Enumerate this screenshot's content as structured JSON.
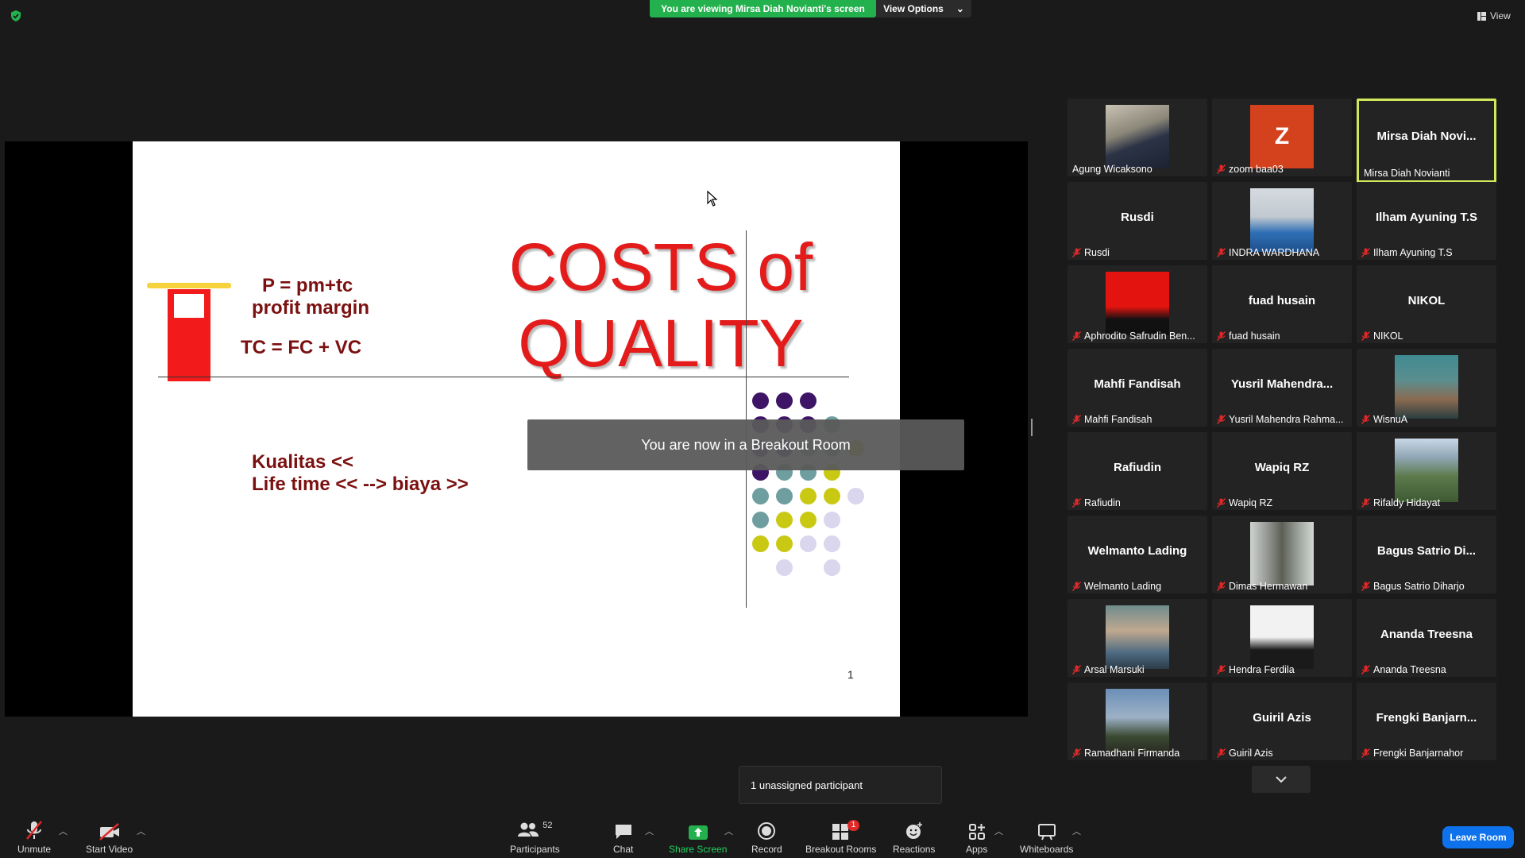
{
  "top": {
    "viewing_banner": "You are viewing Mirsa Diah Novianti's screen",
    "view_options": "View Options",
    "view": "View"
  },
  "slide": {
    "title_line1": "COSTS of",
    "title_line2": "QUALITY",
    "formula_p": "P = pm+tc",
    "formula_pm": "profit margin",
    "formula_tc": "TC = FC + VC",
    "kualitas_line1": "Kualitas <<",
    "kualitas_line2": "Life time << --> biaya >>",
    "page_number": "1"
  },
  "toast": "You are now in a Breakout Room",
  "unassigned": "1 unassigned participant",
  "participants": [
    {
      "big": "",
      "name": "Agung Wicaksono",
      "muted": false,
      "photo": "photo-man-dark"
    },
    {
      "big": "Z",
      "name": "zoom baa03",
      "muted": true,
      "photo": "avatar-z"
    },
    {
      "big": "Mirsa  Diah  Novi...",
      "name": "Mirsa Diah Novianti",
      "muted": false,
      "photo": ""
    },
    {
      "big": "Rusdi",
      "name": "Rusdi",
      "muted": true,
      "photo": ""
    },
    {
      "big": "",
      "name": "INDRA WARDHANA",
      "muted": true,
      "photo": "photo-blue"
    },
    {
      "big": "Ilham Ayuning T.S",
      "name": "Ilham Ayuning T.S",
      "muted": true,
      "photo": ""
    },
    {
      "big": "",
      "name": "Aphrodito Safrudin Ben...",
      "muted": true,
      "photo": "photo-red"
    },
    {
      "big": "fuad husain",
      "name": "fuad husain",
      "muted": true,
      "photo": ""
    },
    {
      "big": "NIKOL",
      "name": "NIKOL",
      "muted": true,
      "photo": ""
    },
    {
      "big": "Mahfi Fandisah",
      "name": "Mahfi Fandisah",
      "muted": true,
      "photo": ""
    },
    {
      "big": "Yusril  Mahendra...",
      "name": "Yusril Mahendra Rahma...",
      "muted": true,
      "photo": ""
    },
    {
      "big": "",
      "name": "WisnuA",
      "muted": true,
      "photo": "photo-teal"
    },
    {
      "big": "Rafiudin",
      "name": "Rafiudin",
      "muted": true,
      "photo": ""
    },
    {
      "big": "Wapiq RZ",
      "name": "Wapiq RZ",
      "muted": true,
      "photo": ""
    },
    {
      "big": "",
      "name": "Rifaldy Hidayat",
      "muted": true,
      "photo": "photo-park"
    },
    {
      "big": "Welmanto Lading",
      "name": "Welmanto Lading",
      "muted": true,
      "photo": ""
    },
    {
      "big": "",
      "name": "Dimas Hermawan",
      "muted": true,
      "photo": "photo-forest"
    },
    {
      "big": "Bagus  Satrio  Di...",
      "name": "Bagus Satrio Diharjo",
      "muted": true,
      "photo": ""
    },
    {
      "big": "",
      "name": "Arsal Marsuki",
      "muted": true,
      "photo": "photo-outdoor"
    },
    {
      "big": "",
      "name": "Hendra Ferdila",
      "muted": true,
      "photo": "photo-suit"
    },
    {
      "big": "Ananda Treesna",
      "name": "Ananda Treesna",
      "muted": true,
      "photo": ""
    },
    {
      "big": "",
      "name": "Ramadhani Firmanda",
      "muted": true,
      "photo": "photo-sky"
    },
    {
      "big": "Guiril Azis",
      "name": "Guiril Azis",
      "muted": true,
      "photo": ""
    },
    {
      "big": "Frengki  Banjarn...",
      "name": "Frengki Banjarnahor",
      "muted": true,
      "photo": ""
    }
  ],
  "toolbar": {
    "unmute": "Unmute",
    "start_video": "Start Video",
    "participants": "Participants",
    "participants_count": "52",
    "chat": "Chat",
    "share_screen": "Share Screen",
    "record": "Record",
    "breakout_rooms": "Breakout Rooms",
    "breakout_badge": "1",
    "reactions": "Reactions",
    "apps": "Apps",
    "whiteboards": "Whiteboards",
    "leave_room": "Leave Room"
  },
  "colors": {
    "banner_green": "#23b14d",
    "slide_red": "#e31b1b",
    "slide_maroon": "#7b1010",
    "active_border": "#cfe85c",
    "leave_blue": "#0e72ed",
    "share_green": "#23b14d"
  }
}
